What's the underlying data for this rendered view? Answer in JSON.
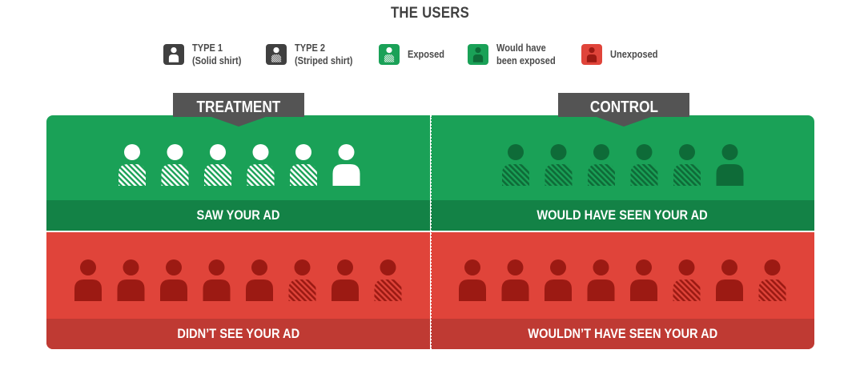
{
  "title": "THE USERS",
  "legend": [
    {
      "key": "type1",
      "label": "TYPE 1\n(Solid shirt)",
      "color": "#404040",
      "pattern": "solid"
    },
    {
      "key": "type2",
      "label": "TYPE 2\n(Striped shirt)",
      "color": "#404040",
      "pattern": "striped"
    },
    {
      "key": "exposed",
      "label": "Exposed",
      "color": "#1aa157",
      "pattern": "striped-light"
    },
    {
      "key": "would_exposed",
      "label": "Would have\nbeen exposed",
      "color": "#1aa157",
      "pattern": "solid-dark"
    },
    {
      "key": "unexposed",
      "label": "Unexposed",
      "color": "#e0443a",
      "pattern": "solid-dark"
    }
  ],
  "treatment": {
    "label": "TREATMENT"
  },
  "control": {
    "label": "CONTROL"
  },
  "quadrants": {
    "treatment_exposed": {
      "label": "SAW YOUR AD",
      "people": [
        "striped",
        "striped",
        "striped",
        "striped",
        "striped",
        "solid"
      ]
    },
    "control_exposed": {
      "label": "WOULD HAVE SEEN YOUR AD",
      "people": [
        "striped",
        "striped",
        "striped",
        "striped",
        "striped",
        "solid"
      ]
    },
    "treatment_unexposed": {
      "label": "DIDN’T SEE YOUR AD",
      "people": [
        "solid",
        "solid",
        "solid",
        "solid",
        "solid",
        "striped",
        "solid",
        "striped"
      ]
    },
    "control_unexposed": {
      "label": "WOULDN’T HAVE SEEN YOUR AD",
      "people": [
        "solid",
        "solid",
        "solid",
        "solid",
        "solid",
        "striped",
        "solid",
        "striped"
      ]
    }
  },
  "colors": {
    "green": "#1aa157",
    "green_dark": "#138246",
    "green_figure": "#0e6b38",
    "red": "#e0443a",
    "red_dark": "#bf3a33",
    "red_figure": "#9c1a13",
    "tag": "#545454",
    "legend_icon": "#404040"
  }
}
